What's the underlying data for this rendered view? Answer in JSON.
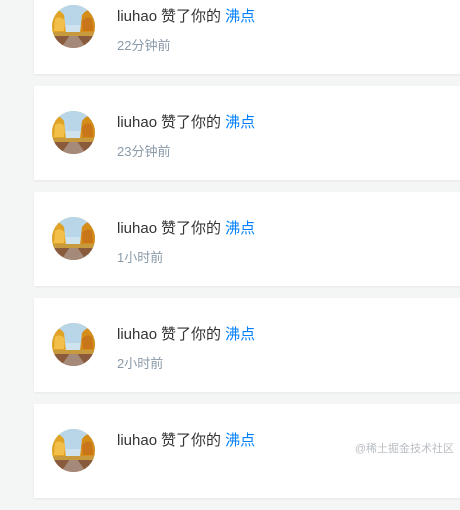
{
  "notifications": [
    {
      "user": "liuhao",
      "action": "赞了你的",
      "target": "沸点",
      "time": "22分钟前"
    },
    {
      "user": "liuhao",
      "action": "赞了你的",
      "target": "沸点",
      "time": "23分钟前"
    },
    {
      "user": "liuhao",
      "action": "赞了你的",
      "target": "沸点",
      "time": "1小时前"
    },
    {
      "user": "liuhao",
      "action": "赞了你的",
      "target": "沸点",
      "time": "2小时前"
    },
    {
      "user": "liuhao",
      "action": "赞了你的",
      "target": "沸点",
      "time": ""
    }
  ],
  "watermark": "@稀土掘金技术社区",
  "colors": {
    "link": "#007fff",
    "meta": "#8a9aa9",
    "page_bg": "#f4f5f5"
  }
}
